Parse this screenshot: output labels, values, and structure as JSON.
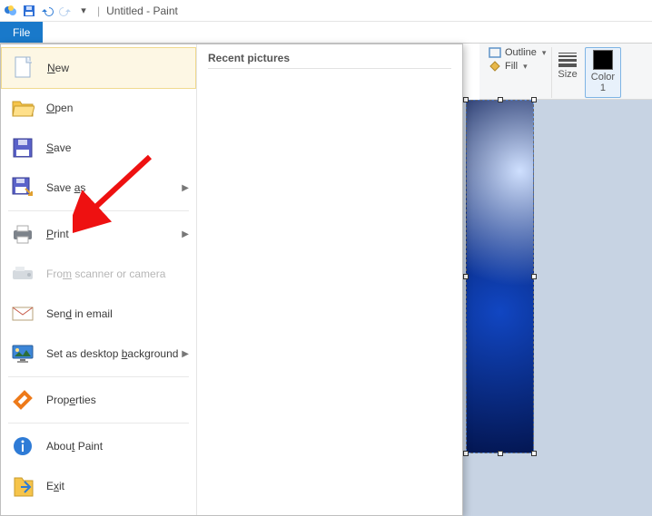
{
  "titlebar": {
    "title": "Untitled - Paint"
  },
  "tab": {
    "file_label": "File"
  },
  "ribbon": {
    "outline_label": "Outline",
    "fill_label": "Fill",
    "size_label": "Size",
    "color1_label": "Color\n1"
  },
  "file_menu": {
    "recent_header": "Recent pictures",
    "items": {
      "new": "New",
      "open": "Open",
      "save": "Save",
      "save_as": "Save as",
      "print": "Print",
      "scanner": "From scanner or camera",
      "email": "Send in email",
      "wallpaper": "Set as desktop background",
      "properties": "Properties",
      "about": "About Paint",
      "exit": "Exit"
    }
  }
}
